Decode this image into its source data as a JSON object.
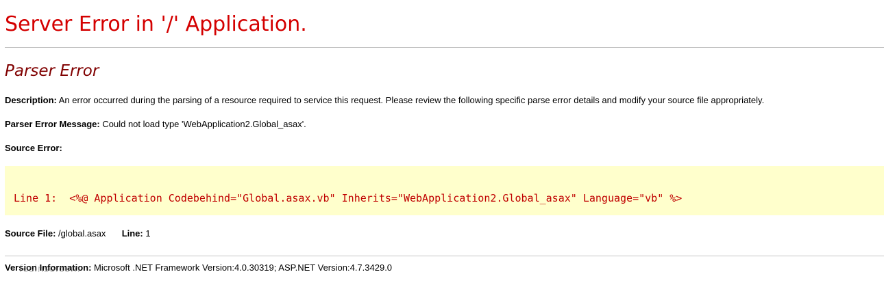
{
  "header": {
    "title": "Server Error in '/' Application."
  },
  "error": {
    "type": "Parser Error",
    "description_label": "Description:",
    "description_text": "An error occurred during the parsing of a resource required to service this request. Please review the following specific parse error details and modify your source file appropriately.",
    "message_label": "Parser Error Message:",
    "message_text": "Could not load type 'WebApplication2.Global_asax'.",
    "source_error_label": "Source Error:"
  },
  "source_code": {
    "line_prefix": "Line 1:",
    "code": "<%@ Application Codebehind=\"Global.asax.vb\" Inherits=\"WebApplication2.Global_asax\" Language=\"vb\" %>"
  },
  "source_file": {
    "file_label": "Source File:",
    "file_value": "/global.asax",
    "line_label": "Line:",
    "line_value": "1"
  },
  "version": {
    "label": "Version Information:",
    "text": "Microsoft .NET Framework Version:4.0.30319; ASP.NET Version:4.7.3429.0"
  },
  "watermark": {
    "text": "fosinso.com"
  },
  "colors": {
    "title": "#d40000",
    "subtitle": "#800000",
    "code_text": "#c00000",
    "code_background": "#ffffcc",
    "rule": "#c4c4c4"
  }
}
